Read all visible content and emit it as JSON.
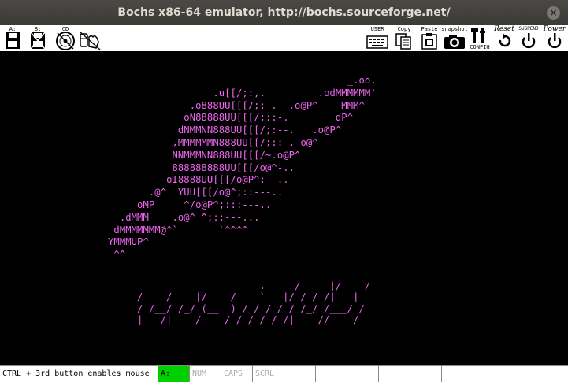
{
  "window": {
    "title": "Bochs x86-64 emulator, http://bochs.sourceforge.net/"
  },
  "toolbar": {
    "floppy_a_label": "A:",
    "floppy_b_label": "B:",
    "cdrom_label": "CD",
    "user_label": "USER",
    "copy_label": "Copy",
    "paste_label": "Paste",
    "snapshot_label": "snapshot",
    "config_label": "CONFIG",
    "reset_label": "Reset",
    "suspend_label": "SUSPEND",
    "power_label": "Power"
  },
  "screen": {
    "logo_lines": [
      "                                         _.oo.",
      "                 _.u[[/;:,.         .odMMMMMM'",
      "              .o888UU[[[/;:-.  .o@P^    MMM^",
      "             oN88888UU[[[/;::-.        dP^",
      "            dNMMNN888UU[[[/;:--.   .o@P^",
      "           ,MMMMMMN888UU[[/;::-. o@^",
      "           NNMMMNN888UU[[[/~.o@P^",
      "           888888888UU[[[/o@^-..",
      "          oI8888UU[[[/o@P^:--..",
      "       .@^  YUU[[[/o@^;::---..",
      "     oMP     ^/o@P^;:::---..",
      "  .dMMM    .o@^ ^;::---...",
      " dMMMMMMM@^`       `^^^^",
      "YMMMUP^",
      " ^^"
    ],
    "banner_lines": [
      "                             ____  _____",
      " _________  _________.___  /  __ |/ ___/",
      "/ ___/ __ |/ ___/ __ `__ |/ / / /|__ |",
      "/ /__/ /_/ (__  ) / / / / / /_/ /___/ /",
      "|___/|____/____/_/ /_/ /_/|____//____/"
    ]
  },
  "statusbar": {
    "message": "CTRL + 3rd button enables mouse",
    "drive": "A:",
    "num": "NUM",
    "caps": "CAPS",
    "scrl": "SCRL"
  },
  "colors": {
    "text": "#ee66ee",
    "screen_bg": "#000000",
    "status_active": "#00d000"
  }
}
